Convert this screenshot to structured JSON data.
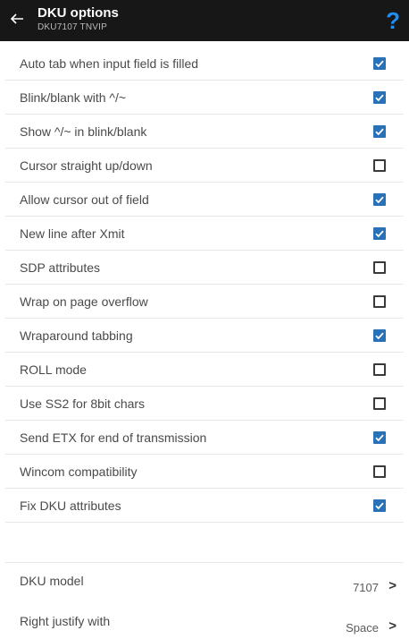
{
  "header": {
    "title": "DKU options",
    "subtitle": "DKU7107 TNVIP",
    "help_glyph": "?"
  },
  "colors": {
    "appbar": "#171717",
    "accent": "#2a72b8",
    "help": "#1f8ef1"
  },
  "options": [
    {
      "label": "Auto tab when input field is filled",
      "checked": true
    },
    {
      "label": "Blink/blank with ^/~",
      "checked": true
    },
    {
      "label": "Show ^/~ in blink/blank",
      "checked": true
    },
    {
      "label": "Cursor straight up/down",
      "checked": false
    },
    {
      "label": "Allow cursor out of field",
      "checked": true
    },
    {
      "label": "New line after Xmit",
      "checked": true
    },
    {
      "label": "SDP attributes",
      "checked": false
    },
    {
      "label": "Wrap on page overflow",
      "checked": false
    },
    {
      "label": "Wraparound tabbing",
      "checked": true
    },
    {
      "label": "ROLL mode",
      "checked": false
    },
    {
      "label": "Use SS2 for 8bit chars",
      "checked": false
    },
    {
      "label": "Send ETX for end of transmission",
      "checked": true
    },
    {
      "label": "Wincom compatibility",
      "checked": false
    },
    {
      "label": "Fix DKU attributes",
      "checked": true
    }
  ],
  "settings": {
    "dku_model": {
      "label": "DKU model",
      "value": "7107",
      "chevron": ">"
    },
    "right_justify": {
      "label": "Right justify with",
      "value": "Space",
      "chevron": ">"
    }
  }
}
